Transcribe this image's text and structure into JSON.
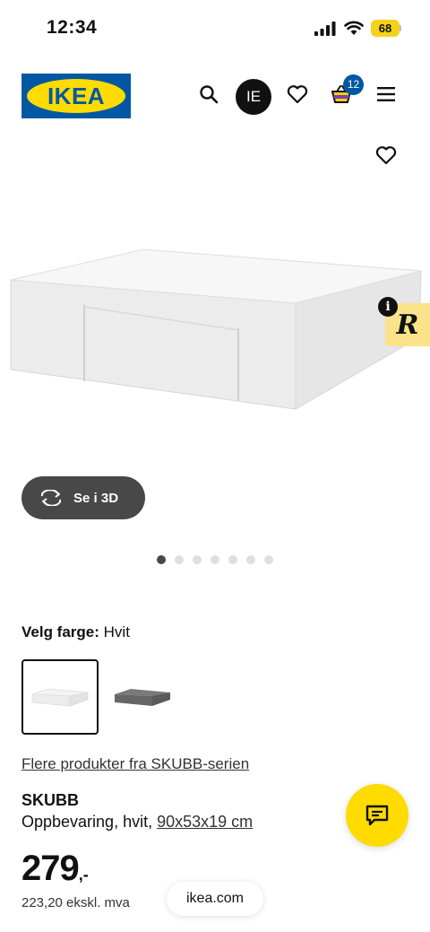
{
  "status_bar": {
    "time": "12:34",
    "battery": "68"
  },
  "header": {
    "logo_text": "IKEA",
    "profile_initials": "IE",
    "cart_count": "12"
  },
  "product": {
    "view_3d_label": "Se i 3D",
    "image_count": 7,
    "active_image": 1,
    "color_label": "Velg farge:",
    "color_value": "Hvit",
    "swatches": [
      "white",
      "dark-grey"
    ],
    "series_link": "Flere produkter fra SKUBB-serien",
    "name": "SKUBB",
    "description": "Oppbevaring, hvit, ",
    "dimensions": "90x53x19 cm",
    "price": "279",
    "price_suffix": ",-",
    "price_ex_vat": "223,20 ekskl. mva"
  },
  "browser": {
    "url": "ikea.com"
  },
  "colors": {
    "ikea_blue": "#0058a3",
    "ikea_yellow": "#ffdb00",
    "dark_button": "#484848"
  }
}
